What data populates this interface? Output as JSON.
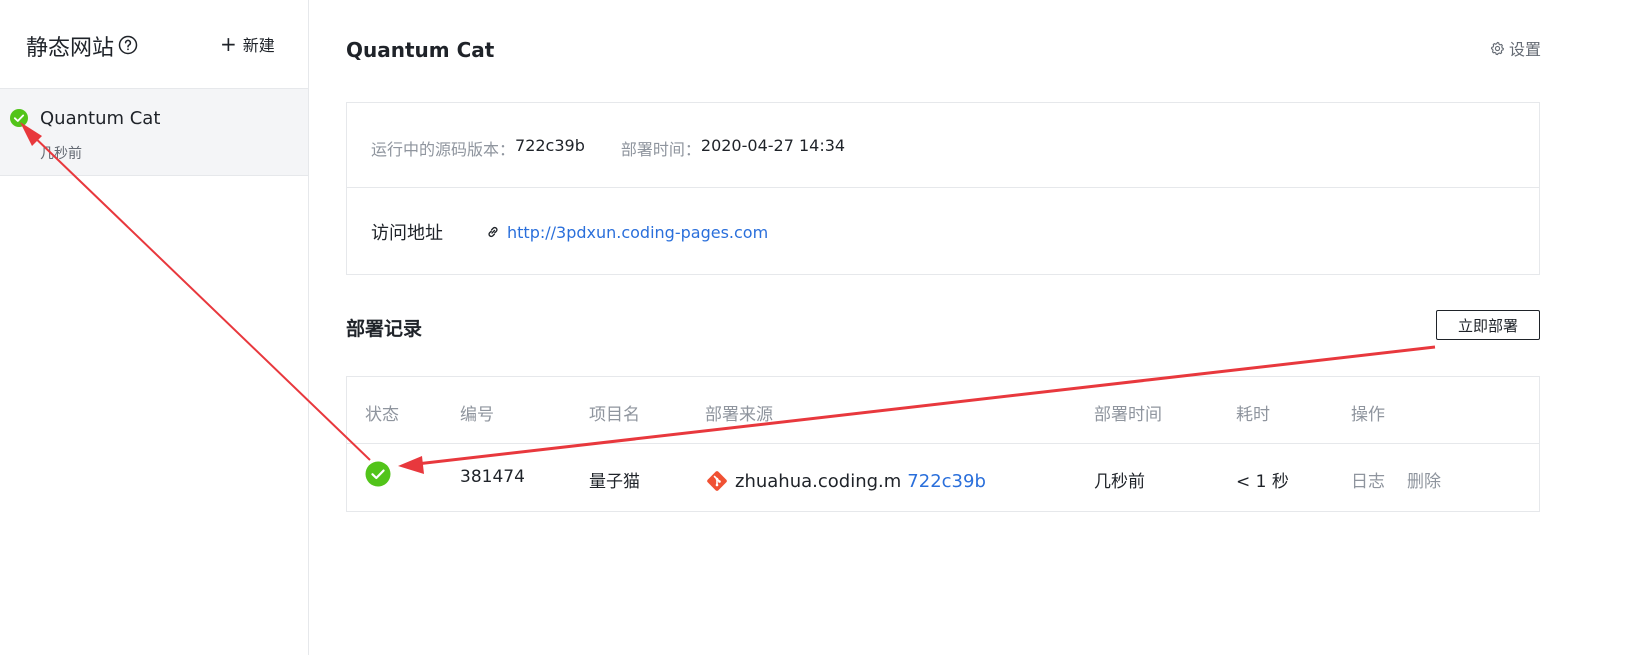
{
  "sidebar": {
    "title": "静态网站",
    "new_label": "新建",
    "sites": [
      {
        "name": "Quantum Cat",
        "time": "几秒前",
        "status": "success"
      }
    ]
  },
  "main": {
    "title": "Quantum Cat",
    "settings_label": "设置",
    "info": {
      "version_label": "运行中的源码版本：",
      "version_value": "722c39b",
      "deploy_time_label": "部署时间：",
      "deploy_time_value": "2020-04-27 14:34",
      "address_label": "访问地址",
      "address_url": "http://3pdxun.coding-pages.com"
    },
    "records": {
      "title": "部署记录",
      "deploy_now_label": "立即部署",
      "columns": [
        "状态",
        "编号",
        "项目名",
        "部署来源",
        "部署时间",
        "耗时",
        "操作"
      ],
      "rows": [
        {
          "status": "success",
          "id": "381474",
          "project": "量子猫",
          "source": "zhuahua.coding.m",
          "commit": "722c39b",
          "deploy_time": "几秒前",
          "duration": "< 1 秒",
          "actions": [
            "日志",
            "删除"
          ]
        }
      ]
    }
  },
  "colors": {
    "success": "#52c41a",
    "link": "#2a6fdb",
    "git": "#f05133",
    "annotation": "#e8383d"
  },
  "icons": {
    "help": "help-circle-icon",
    "settings": "gear-icon",
    "link": "link-icon",
    "status": "check-circle-icon",
    "source": "git-icon"
  }
}
